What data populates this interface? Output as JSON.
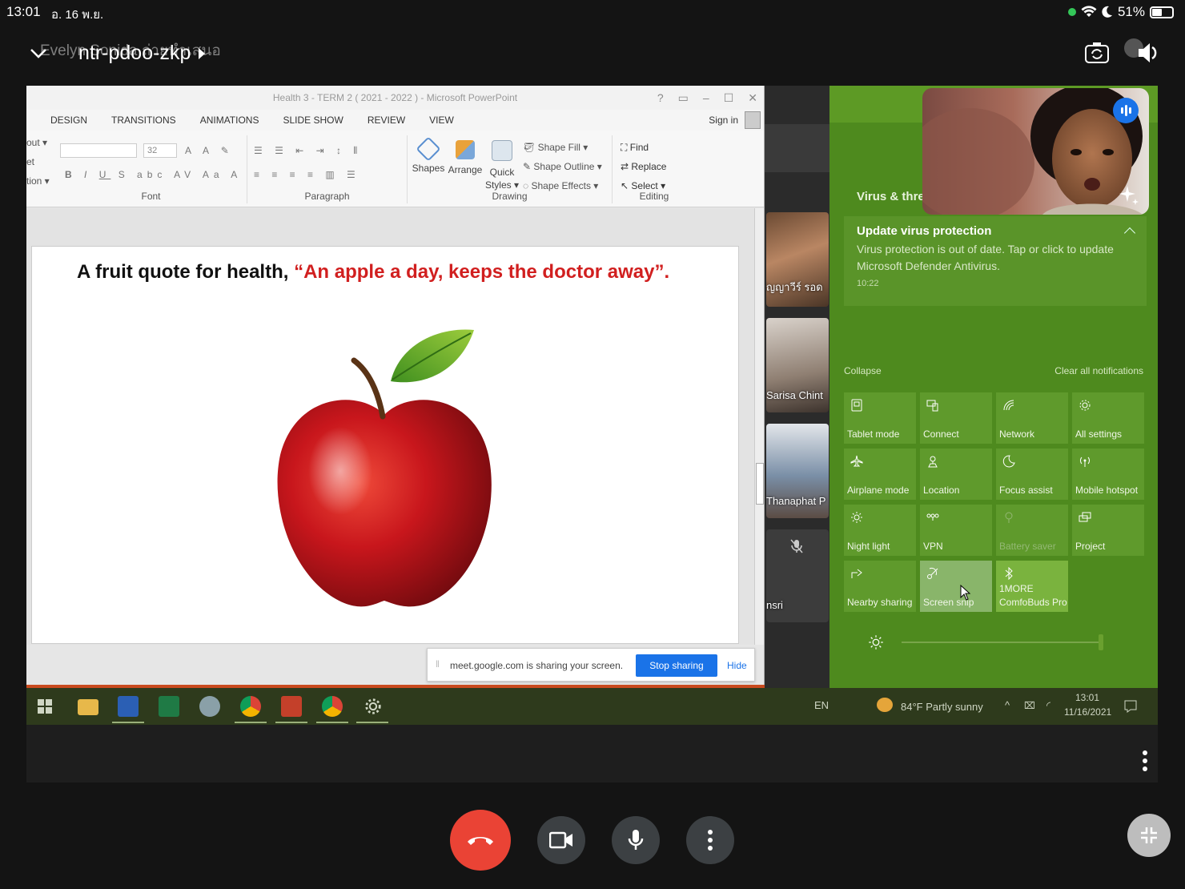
{
  "status_bar": {
    "time": "13:01",
    "date": "อ. 16 พ.ย.",
    "battery": "51%"
  },
  "meet_header": {
    "ghost_name": "Evelyn Sonida ถ่ายทำเสนอ",
    "meeting_code": "ntr-pdoo-zkp"
  },
  "powerpoint": {
    "window_title": "Health 3 - TERM 2 ( 2021 - 2022 ) - Microsoft PowerPoint",
    "tabs": [
      "DESIGN",
      "TRANSITIONS",
      "ANIMATIONS",
      "SLIDE SHOW",
      "REVIEW",
      "VIEW"
    ],
    "sign_in": "Sign in",
    "ribbon": {
      "cut_labels": [
        "out ▾",
        "et",
        "tion ▾"
      ],
      "font_size": "32",
      "groups": [
        "Font",
        "Paragraph",
        "Drawing",
        "Editing"
      ],
      "shapes": "Shapes",
      "arrange": "Arrange",
      "quick_styles_1": "Quick",
      "quick_styles_2": "Styles ▾",
      "shape_fill": "Shape Fill ▾",
      "shape_outline": "Shape Outline ▾",
      "shape_effects": "Shape Effects ▾",
      "find": "Find",
      "replace": "Replace",
      "select": "Select ▾"
    },
    "slide": {
      "quote_prefix": "A fruit quote for health,",
      "quote_red": "“An apple a day, keeps the doctor away”",
      "quote_end": "."
    }
  },
  "share_bar": {
    "message": "meet.google.com is sharing your screen.",
    "stop": "Stop sharing",
    "hide": "Hide"
  },
  "participants": [
    {
      "name": "ัญญาวีร์ รอด"
    },
    {
      "name": "Sarisa Chint"
    },
    {
      "name": "Thanaphat P"
    },
    {
      "name": "nsri"
    }
  ],
  "action_center": {
    "section_title": "Virus & thre",
    "notification": {
      "title": "Update virus protection",
      "body": "Virus protection is out of date. Tap or click to update Microsoft Defender Antivirus.",
      "time": "10:22"
    },
    "collapse": "Collapse",
    "clear_all": "Clear all notifications",
    "quick_actions": [
      {
        "label": "Tablet mode",
        "icon": "tablet-icon"
      },
      {
        "label": "Connect",
        "icon": "connect-icon"
      },
      {
        "label": "Network",
        "icon": "network-icon"
      },
      {
        "label": "All settings",
        "icon": "gear-icon"
      },
      {
        "label": "Airplane mode",
        "icon": "airplane-icon"
      },
      {
        "label": "Location",
        "icon": "location-icon"
      },
      {
        "label": "Focus assist",
        "icon": "moon-icon"
      },
      {
        "label": "Mobile hotspot",
        "icon": "hotspot-icon"
      },
      {
        "label": "Night light",
        "icon": "sun-icon"
      },
      {
        "label": "VPN",
        "icon": "vpn-icon"
      },
      {
        "label": "Battery saver",
        "icon": "battery-icon"
      },
      {
        "label": "Project",
        "icon": "project-icon"
      },
      {
        "label": "Nearby sharing",
        "icon": "share-icon"
      },
      {
        "label": "Screen snip",
        "icon": "snip-icon"
      },
      {
        "label_1": "1MORE",
        "label_2": "ComfoBuds Pro",
        "icon": "bluetooth-icon"
      }
    ]
  },
  "taskbar": {
    "lang": "EN",
    "weather": "84°F  Partly sunny",
    "clock_time": "13:01",
    "clock_date": "11/16/2021"
  },
  "colors": {
    "action_center_bg": "#4e8a1e",
    "end_call": "#ea4335",
    "accent_blue": "#1a73e8",
    "quote_red": "#d11f1f"
  }
}
